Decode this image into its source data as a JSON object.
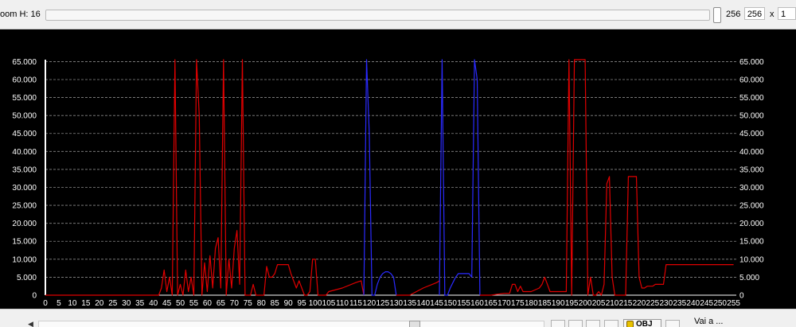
{
  "toolbar": {
    "zoom_label": "oom H: 16",
    "slider_value": "256",
    "value_box": "256",
    "multiplier_symbol": "x",
    "multiplier_value": "1"
  },
  "status": {
    "obj_label": "OBJ",
    "goto_label": "Vai a ..."
  },
  "colors": {
    "series_red": "#e00000",
    "series_blue": "#2a2aff",
    "background": "#000000",
    "grid": "#8a8a8a"
  },
  "chart_data": {
    "type": "line",
    "title": "",
    "xlabel": "",
    "ylabel": "",
    "xlim": [
      0,
      256
    ],
    "ylim": [
      0,
      65535
    ],
    "grid": true,
    "x_ticks": [
      "0",
      "5",
      "10",
      "15",
      "20",
      "25",
      "30",
      "35",
      "40",
      "45",
      "50",
      "55",
      "60",
      "65",
      "70",
      "75",
      "80",
      "85",
      "90",
      "95",
      "100",
      "105",
      "110",
      "115",
      "120",
      "125",
      "130",
      "135",
      "140",
      "145",
      "150",
      "155",
      "160",
      "165",
      "170",
      "175",
      "180",
      "185",
      "190",
      "195",
      "200",
      "205",
      "210",
      "215",
      "220",
      "225",
      "230",
      "235",
      "240",
      "245",
      "250",
      "255"
    ],
    "y_ticks": [
      "0",
      "5.000",
      "10.000",
      "15.000",
      "20.000",
      "25.000",
      "30.000",
      "35.000",
      "40.000",
      "45.000",
      "50.000",
      "55.000",
      "60.000",
      "65.000"
    ],
    "series": [
      {
        "color": "#e00000",
        "x": [
          0,
          42,
          43,
          44,
          45,
          46,
          47,
          48,
          49,
          50,
          51,
          52,
          53,
          54,
          55,
          56,
          57,
          58,
          59,
          60,
          61,
          62,
          63,
          64,
          65,
          66,
          67,
          68,
          69,
          70,
          71,
          72,
          73,
          74,
          75,
          76,
          77,
          78,
          79,
          80,
          81,
          82,
          83,
          84,
          85,
          86,
          87,
          88,
          89,
          90,
          91,
          92,
          93,
          94,
          95,
          96,
          97,
          98,
          99,
          100,
          101,
          102,
          103,
          104,
          105,
          110,
          115,
          117,
          118
        ],
        "y": [
          0,
          0,
          2000,
          7000,
          1000,
          5000,
          0,
          65535,
          0,
          3000,
          0,
          7000,
          1000,
          5000,
          0,
          65535,
          50000,
          0,
          9000,
          1000,
          11000,
          2000,
          13000,
          16000,
          2000,
          65535,
          0,
          10000,
          2000,
          13000,
          18000,
          3000,
          65535,
          0,
          0,
          0,
          3000,
          0,
          0,
          0,
          0,
          8000,
          5000,
          5000,
          6000,
          8500,
          8500,
          8500,
          8500,
          8500,
          6000,
          4000,
          2000,
          4000,
          2000,
          0,
          0,
          1000,
          10000,
          10000,
          0,
          0,
          0,
          0,
          1000,
          2000,
          3500,
          4000,
          0
        ]
      },
      {
        "color": "#2a2aff",
        "x": [
          118,
          119,
          120,
          121,
          122,
          123,
          124,
          125,
          126,
          127,
          128,
          129,
          130
        ],
        "y": [
          0,
          65535,
          45000,
          0,
          0,
          3000,
          5000,
          6000,
          6500,
          6500,
          6000,
          5000,
          0
        ]
      },
      {
        "color": "#e00000",
        "x": [
          130,
          135,
          140,
          145,
          146
        ],
        "y": [
          0,
          0,
          2000,
          3500,
          4000
        ]
      },
      {
        "color": "#2a2aff",
        "x": [
          146,
          147,
          148,
          149,
          150,
          151,
          152,
          153,
          154,
          155,
          156,
          157,
          158,
          159,
          160,
          161
        ],
        "y": [
          0,
          65535,
          0,
          0,
          2000,
          3500,
          5000,
          6000,
          6000,
          6000,
          6000,
          6000,
          5000,
          65535,
          60000,
          0
        ]
      },
      {
        "color": "#e00000",
        "x": [
          161,
          165,
          170,
          172,
          173,
          174,
          175,
          176,
          177,
          180,
          183,
          184,
          185,
          186,
          187,
          190,
          193,
          194,
          195,
          196,
          197,
          198,
          199,
          200,
          201,
          202,
          203,
          204,
          205,
          206,
          207,
          208,
          209,
          210,
          211,
          212,
          213,
          214,
          215,
          216,
          217,
          218,
          219,
          220,
          221,
          222,
          223,
          224,
          225,
          226,
          227,
          228,
          229,
          230,
          231,
          232,
          240,
          245,
          250,
          255
        ],
        "y": [
          0,
          0,
          500,
          500,
          3000,
          3000,
          1000,
          2500,
          1000,
          1000,
          2000,
          3000,
          5000,
          3000,
          1000,
          1000,
          1000,
          65535,
          0,
          65535,
          65535,
          65535,
          65535,
          65535,
          0,
          5000,
          0,
          0,
          1000,
          0,
          3000,
          31000,
          33000,
          5000,
          0,
          0,
          0,
          0,
          0,
          33000,
          33000,
          33000,
          33000,
          5000,
          2000,
          2000,
          2500,
          2500,
          2500,
          3000,
          3000,
          3000,
          3000,
          8500,
          8500,
          8500,
          8500,
          8500,
          8500,
          8500
        ]
      }
    ]
  }
}
